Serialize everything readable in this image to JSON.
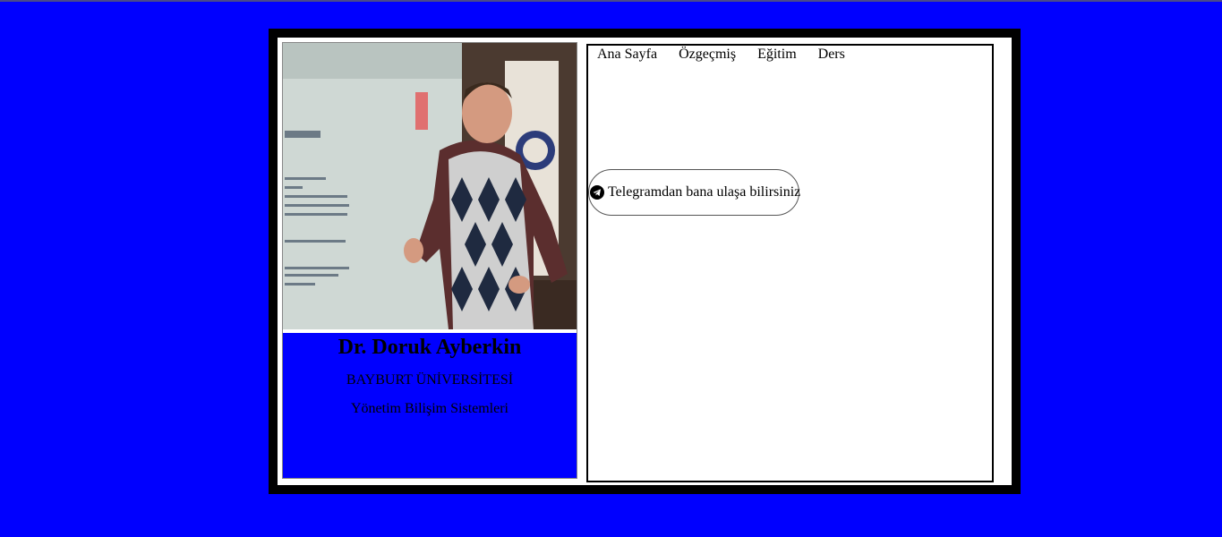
{
  "profile": {
    "name": "Dr. Doruk Ayberkin",
    "university": "BAYBURT ÜNİVERSİTESİ",
    "department": "Yönetim Bilişim Sistemleri"
  },
  "nav": {
    "items": [
      "Ana Sayfa",
      "Özgeçmiş",
      "Eğitim",
      "Ders"
    ]
  },
  "telegram": {
    "label": "Telegramdan bana ulaşa bilirsiniz",
    "icon": "telegram-icon"
  },
  "colors": {
    "background": "#0000ff",
    "frame": "#000000",
    "panel": "#ffffff"
  }
}
